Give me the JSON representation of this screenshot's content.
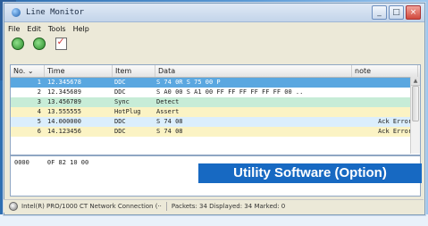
{
  "window": {
    "title": "Line Monitor",
    "controls": {
      "minimize": "_",
      "maximize": "□",
      "close": "×"
    }
  },
  "menu": [
    "File",
    "Edit",
    "Tools",
    "Help"
  ],
  "toolbar": {
    "icons": [
      "gear-green-icon",
      "gear-green-icon",
      "checklist-icon"
    ]
  },
  "table": {
    "columns": [
      "No. ⌄",
      "Time",
      "Item",
      "Data",
      "note"
    ],
    "rows": [
      {
        "no": "1",
        "time": "12.345678",
        "item": "DDC",
        "data": "S 74 0R S 75 00 P",
        "note": ""
      },
      {
        "no": "2",
        "time": "12.345689",
        "item": "DDC",
        "data": "S A0 00 S A1 00 FF FF FF FF FF FF 00 ..",
        "note": ""
      },
      {
        "no": "3",
        "time": "13.456789",
        "item": "Sync",
        "data": "Detect",
        "note": ""
      },
      {
        "no": "4",
        "time": "13.555555",
        "item": "HotPlug",
        "data": "Assert",
        "note": ""
      },
      {
        "no": "5",
        "time": "14.000000",
        "item": "DDC",
        "data": "S 74 08",
        "note": "Ack Error"
      },
      {
        "no": "6",
        "time": "14.123456",
        "item": "DDC",
        "data": "S 74 08",
        "note": "Ack Error"
      }
    ]
  },
  "hex": {
    "offset": "0000",
    "bytes": "0F 82 10 00"
  },
  "overlay_label": "Utility Software (Option)",
  "status": {
    "connection": "Intel(R) PRO/1000 CT Network Connection (··",
    "packets": "Packets: 34 Displayed: 34 Marked: 0"
  },
  "colors": {
    "selected_row": "#5aa7e0",
    "sync_row": "#c7ecd7",
    "hotplug_row": "#fbf3c4",
    "error_row": "#dbeefc",
    "overlay_bg": "#1769c2"
  }
}
